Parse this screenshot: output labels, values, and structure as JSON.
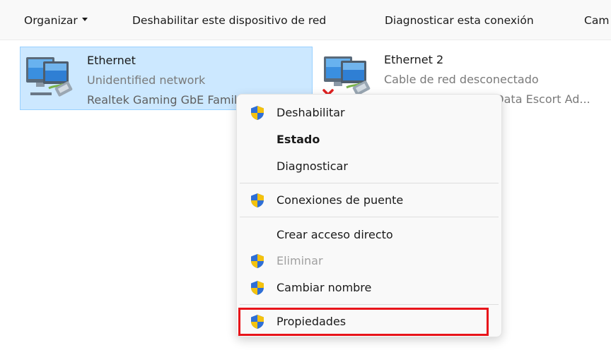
{
  "toolbar": {
    "organizar": "Organizar",
    "deshabilitar": "Deshabilitar este dispositivo de red",
    "diagnosticar": "Diagnosticar esta conexión",
    "cambiar": "Cam"
  },
  "adapters": [
    {
      "name": "Ethernet",
      "status": "Unidentified network",
      "device": "Realtek Gaming GbE Family C",
      "icon": "network-adapter-icon",
      "selected": true
    },
    {
      "name": "Ethernet 2",
      "status": "Cable de red desconectado",
      "device": "Kaspersky Security Data Escort Ad...",
      "icon": "network-adapter-disconnected-icon",
      "selected": false
    }
  ],
  "context_menu": {
    "items": [
      {
        "label": "Deshabilitar",
        "shield": true,
        "bold": false,
        "disabled": false
      },
      {
        "label": "Estado",
        "shield": false,
        "bold": true,
        "disabled": false
      },
      {
        "label": "Diagnosticar",
        "shield": false,
        "bold": false,
        "disabled": false
      },
      {
        "label": "Conexiones de puente",
        "shield": true,
        "bold": false,
        "disabled": false
      },
      {
        "label": "Crear acceso directo",
        "shield": false,
        "bold": false,
        "disabled": false
      },
      {
        "label": "Eliminar",
        "shield": true,
        "bold": false,
        "disabled": true
      },
      {
        "label": "Cambiar nombre",
        "shield": true,
        "bold": false,
        "disabled": false
      },
      {
        "label": "Propiedades",
        "shield": true,
        "bold": false,
        "disabled": false,
        "highlighted": true
      }
    ]
  },
  "colors": {
    "selection_bg": "#cce8ff",
    "highlight_border": "#e8141a",
    "shield_blue": "#2f6fd6",
    "shield_yellow": "#f4c20d"
  }
}
